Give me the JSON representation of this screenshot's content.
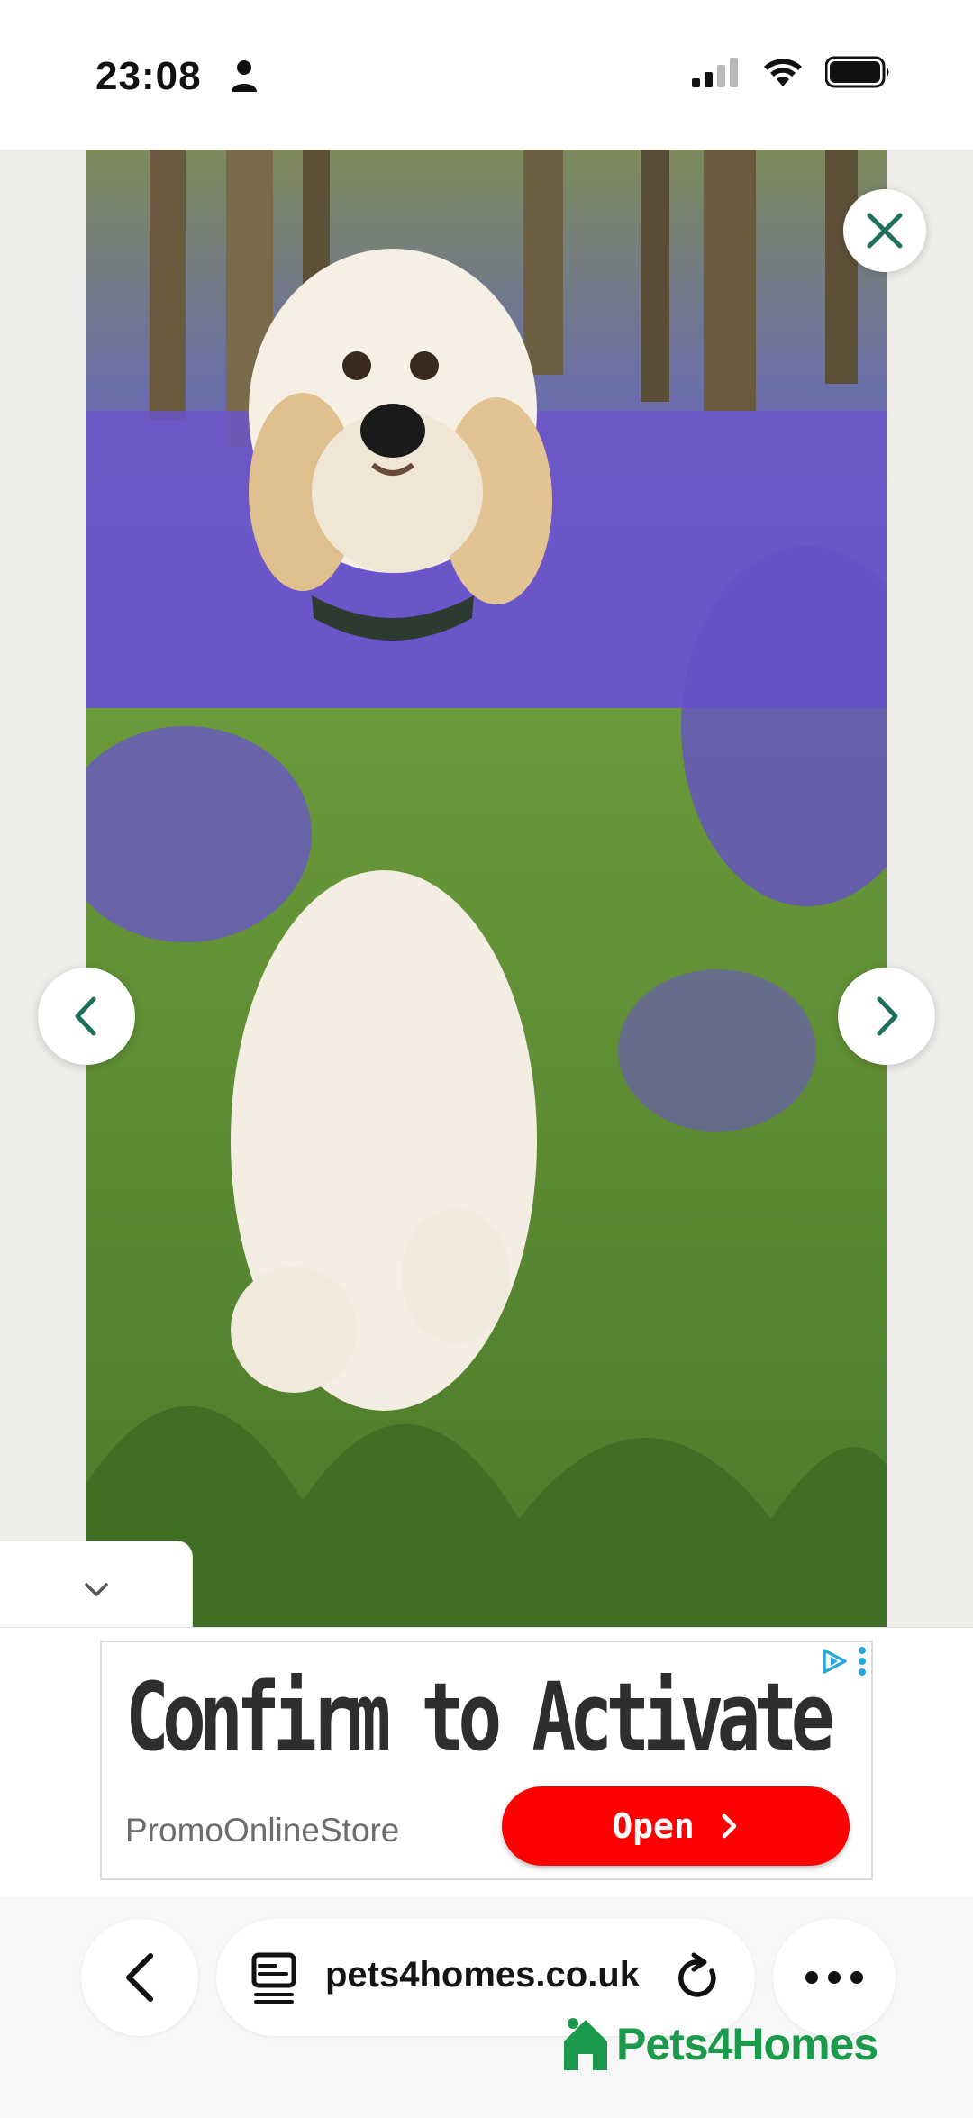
{
  "status_bar": {
    "time": "23:08",
    "person_icon": "person-icon",
    "signal_icon": "cellular-signal-icon",
    "wifi_icon": "wifi-icon",
    "battery_icon": "battery-full-icon"
  },
  "viewer": {
    "photo_description_icon": "dog-photo",
    "close_icon": "close-icon",
    "prev_icon": "chevron-left-icon",
    "next_icon": "chevron-right-icon",
    "collapse_icon": "chevron-down-icon"
  },
  "ad": {
    "headline": "Confirm to Activate",
    "advertiser": "PromoOnlineStore",
    "cta_label": "Open",
    "adchoices_icon": "adchoices-icon",
    "menu_icon": "kebab-menu-icon"
  },
  "browser": {
    "url": "pets4homes.co.uk",
    "back_icon": "back-arrow-icon",
    "tabs_icon": "page-tabs-icon",
    "reload_icon": "reload-icon",
    "more_icon": "more-dots-icon"
  },
  "brand": {
    "name": "Pets4Homes"
  },
  "colors": {
    "accent_green": "#1b9a4b",
    "viewer_button_icon": "#1e6f5c",
    "cta_red": "#ff0000"
  }
}
